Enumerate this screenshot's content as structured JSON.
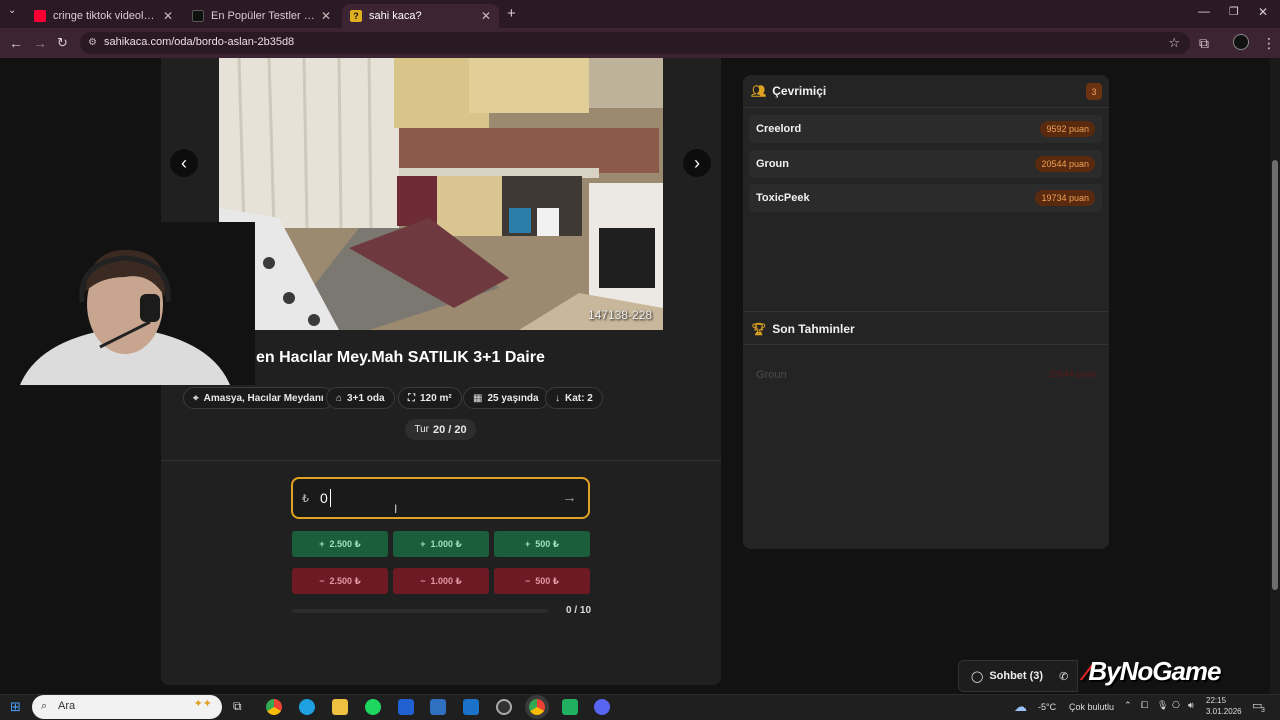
{
  "browser": {
    "tabs": [
      {
        "title": "cringe tiktok videoları - YouTube",
        "favicon_color": "#ff0033"
      },
      {
        "title": "En Popüler Testler ve Eğlenceli Quizler",
        "favicon_color": "#111111"
      },
      {
        "title": "sahi kaca?",
        "favicon_color": "#e0b020",
        "favicon_glyph": "?"
      }
    ],
    "url": "sahikaca.com/oda/bordo-aslan-2b35d8"
  },
  "listing": {
    "photo_id": "147138-228",
    "title": "en Hacılar Mey.Mah SATILIK 3+1 Daire",
    "chips": [
      {
        "icon": "location-pin-icon",
        "label": "Amasya, Hacılar Meydanı"
      },
      {
        "icon": "house-icon",
        "label": "3+1 oda"
      },
      {
        "icon": "area-icon",
        "label": "120 m²"
      },
      {
        "icon": "building-icon",
        "label": "25 yaşında"
      },
      {
        "icon": "down-arrow-icon",
        "label": "Kat: 2"
      }
    ],
    "round_label": "Tur",
    "round_value": "20 / 20"
  },
  "guess": {
    "currency_symbol": "₺",
    "value": "0",
    "plus_buttons": [
      "2.500 ₺",
      "1.000 ₺",
      "500 ₺"
    ],
    "minus_buttons": [
      "2.500 ₺",
      "1.000 ₺",
      "500 ₺"
    ],
    "progress_label": "0 / 10",
    "progress": 0
  },
  "online": {
    "title": "Çevrimiçi",
    "count": "3",
    "players": [
      {
        "name": "Creelord",
        "points": "9592 puan"
      },
      {
        "name": "Groun",
        "points": "20544 puan"
      },
      {
        "name": "ToxicPeek",
        "points": "19734 puan"
      }
    ]
  },
  "latest": {
    "title": "Son Tahminler",
    "entries": [
      {
        "name": "Groun",
        "points": "20544 puan"
      }
    ]
  },
  "chat": {
    "label": "Sohbet (3)"
  },
  "logo": {
    "text": "ByNoGame"
  },
  "taskbar": {
    "search_placeholder": "Ara",
    "weather_temp": "-5°C",
    "weather_desc": "Çok bulutlu",
    "time": "22:15",
    "date": "3.01.2026",
    "notifications": "3"
  },
  "colors": {
    "accent": "#e0a223",
    "plus": "#1b5e3b",
    "minus": "#6d1a24",
    "browser": "#3d2433"
  }
}
